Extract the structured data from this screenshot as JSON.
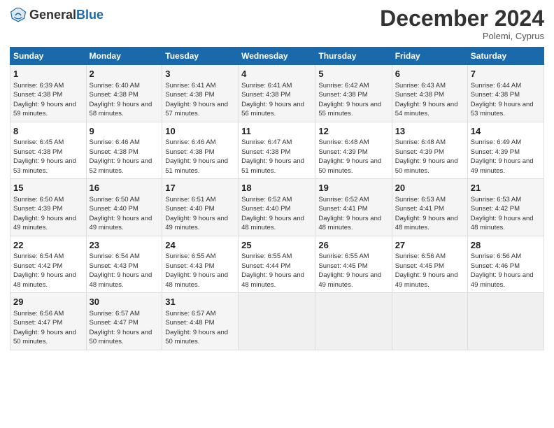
{
  "header": {
    "logo_general": "General",
    "logo_blue": "Blue",
    "month": "December 2024",
    "location": "Polemi, Cyprus"
  },
  "weekdays": [
    "Sunday",
    "Monday",
    "Tuesday",
    "Wednesday",
    "Thursday",
    "Friday",
    "Saturday"
  ],
  "weeks": [
    [
      {
        "day": 1,
        "sunrise": "6:39 AM",
        "sunset": "4:38 PM",
        "daylight": "9 hours and 59 minutes."
      },
      {
        "day": 2,
        "sunrise": "6:40 AM",
        "sunset": "4:38 PM",
        "daylight": "9 hours and 58 minutes."
      },
      {
        "day": 3,
        "sunrise": "6:41 AM",
        "sunset": "4:38 PM",
        "daylight": "9 hours and 57 minutes."
      },
      {
        "day": 4,
        "sunrise": "6:41 AM",
        "sunset": "4:38 PM",
        "daylight": "9 hours and 56 minutes."
      },
      {
        "day": 5,
        "sunrise": "6:42 AM",
        "sunset": "4:38 PM",
        "daylight": "9 hours and 55 minutes."
      },
      {
        "day": 6,
        "sunrise": "6:43 AM",
        "sunset": "4:38 PM",
        "daylight": "9 hours and 54 minutes."
      },
      {
        "day": 7,
        "sunrise": "6:44 AM",
        "sunset": "4:38 PM",
        "daylight": "9 hours and 53 minutes."
      }
    ],
    [
      {
        "day": 8,
        "sunrise": "6:45 AM",
        "sunset": "4:38 PM",
        "daylight": "9 hours and 53 minutes."
      },
      {
        "day": 9,
        "sunrise": "6:46 AM",
        "sunset": "4:38 PM",
        "daylight": "9 hours and 52 minutes."
      },
      {
        "day": 10,
        "sunrise": "6:46 AM",
        "sunset": "4:38 PM",
        "daylight": "9 hours and 51 minutes."
      },
      {
        "day": 11,
        "sunrise": "6:47 AM",
        "sunset": "4:38 PM",
        "daylight": "9 hours and 51 minutes."
      },
      {
        "day": 12,
        "sunrise": "6:48 AM",
        "sunset": "4:39 PM",
        "daylight": "9 hours and 50 minutes."
      },
      {
        "day": 13,
        "sunrise": "6:48 AM",
        "sunset": "4:39 PM",
        "daylight": "9 hours and 50 minutes."
      },
      {
        "day": 14,
        "sunrise": "6:49 AM",
        "sunset": "4:39 PM",
        "daylight": "9 hours and 49 minutes."
      }
    ],
    [
      {
        "day": 15,
        "sunrise": "6:50 AM",
        "sunset": "4:39 PM",
        "daylight": "9 hours and 49 minutes."
      },
      {
        "day": 16,
        "sunrise": "6:50 AM",
        "sunset": "4:40 PM",
        "daylight": "9 hours and 49 minutes."
      },
      {
        "day": 17,
        "sunrise": "6:51 AM",
        "sunset": "4:40 PM",
        "daylight": "9 hours and 49 minutes."
      },
      {
        "day": 18,
        "sunrise": "6:52 AM",
        "sunset": "4:40 PM",
        "daylight": "9 hours and 48 minutes."
      },
      {
        "day": 19,
        "sunrise": "6:52 AM",
        "sunset": "4:41 PM",
        "daylight": "9 hours and 48 minutes."
      },
      {
        "day": 20,
        "sunrise": "6:53 AM",
        "sunset": "4:41 PM",
        "daylight": "9 hours and 48 minutes."
      },
      {
        "day": 21,
        "sunrise": "6:53 AM",
        "sunset": "4:42 PM",
        "daylight": "9 hours and 48 minutes."
      }
    ],
    [
      {
        "day": 22,
        "sunrise": "6:54 AM",
        "sunset": "4:42 PM",
        "daylight": "9 hours and 48 minutes."
      },
      {
        "day": 23,
        "sunrise": "6:54 AM",
        "sunset": "4:43 PM",
        "daylight": "9 hours and 48 minutes."
      },
      {
        "day": 24,
        "sunrise": "6:55 AM",
        "sunset": "4:43 PM",
        "daylight": "9 hours and 48 minutes."
      },
      {
        "day": 25,
        "sunrise": "6:55 AM",
        "sunset": "4:44 PM",
        "daylight": "9 hours and 48 minutes."
      },
      {
        "day": 26,
        "sunrise": "6:55 AM",
        "sunset": "4:45 PM",
        "daylight": "9 hours and 49 minutes."
      },
      {
        "day": 27,
        "sunrise": "6:56 AM",
        "sunset": "4:45 PM",
        "daylight": "9 hours and 49 minutes."
      },
      {
        "day": 28,
        "sunrise": "6:56 AM",
        "sunset": "4:46 PM",
        "daylight": "9 hours and 49 minutes."
      }
    ],
    [
      {
        "day": 29,
        "sunrise": "6:56 AM",
        "sunset": "4:47 PM",
        "daylight": "9 hours and 50 minutes."
      },
      {
        "day": 30,
        "sunrise": "6:57 AM",
        "sunset": "4:47 PM",
        "daylight": "9 hours and 50 minutes."
      },
      {
        "day": 31,
        "sunrise": "6:57 AM",
        "sunset": "4:48 PM",
        "daylight": "9 hours and 50 minutes."
      },
      null,
      null,
      null,
      null
    ]
  ]
}
